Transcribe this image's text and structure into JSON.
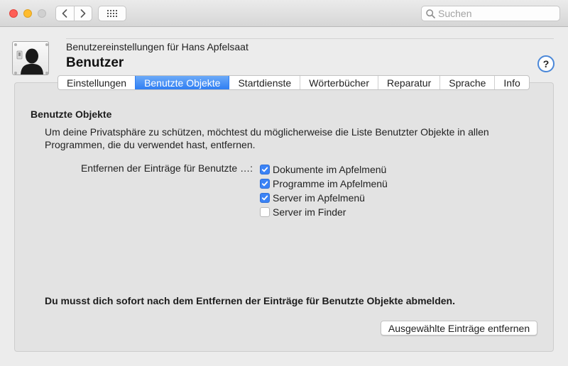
{
  "window": {
    "search_placeholder": "Suchen"
  },
  "header": {
    "subtitle": "Benutzereinstellungen für Hans Apfelsaat",
    "title": "Benutzer",
    "help_label": "?"
  },
  "tabs": [
    {
      "label": "Einstellungen",
      "active": false
    },
    {
      "label": "Benutzte Objekte",
      "active": true
    },
    {
      "label": "Startdienste",
      "active": false
    },
    {
      "label": "Wörterbücher",
      "active": false
    },
    {
      "label": "Reparatur",
      "active": false
    },
    {
      "label": "Sprache",
      "active": false
    },
    {
      "label": "Info",
      "active": false
    }
  ],
  "section": {
    "title": "Benutzte Objekte",
    "description": "Um deine Privatsphäre zu schützen, möchtest du möglicherweise die Liste Benutzter Objekte in allen Programmen, die du verwendet hast, entfernen.",
    "remove_label": "Entfernen der Einträge für Benutzte …:",
    "options": [
      {
        "label": "Dokumente im Apfelmenü",
        "checked": true
      },
      {
        "label": "Programme im Apfelmenü",
        "checked": true
      },
      {
        "label": "Server im Apfelmenü",
        "checked": true
      },
      {
        "label": "Server im Finder",
        "checked": false
      }
    ],
    "warning": "Du musst dich sofort nach dem Entfernen der Einträge für Benutzte Objekte abmelden.",
    "remove_button": "Ausgewählte Einträge entfernen"
  },
  "colors": {
    "accent": "#2f7ef3",
    "close": "#fe5f57",
    "minimize": "#febc2e"
  },
  "icons": {
    "back": "chevron-left-icon",
    "forward": "chevron-right-icon",
    "grid": "grid-icon",
    "search": "search-icon",
    "app": "user-silhouette-icon",
    "check": "checkmark-icon"
  }
}
